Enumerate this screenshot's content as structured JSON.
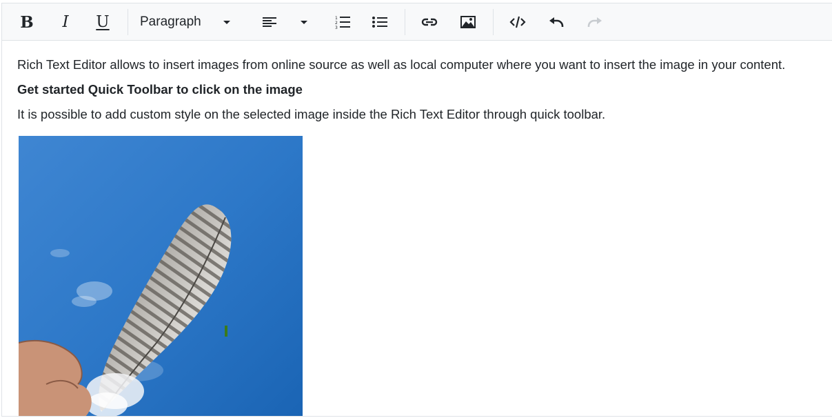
{
  "toolbar": {
    "bold_label": "B",
    "italic_label": "I",
    "underline_label": "U",
    "format_value": "Paragraph",
    "icons": [
      "bold-icon",
      "italic-icon",
      "underline-icon",
      "chevron-down-icon",
      "align-left-icon",
      "ordered-list-icon",
      "unordered-list-icon",
      "link-icon",
      "image-icon",
      "source-code-icon",
      "undo-icon",
      "redo-icon"
    ]
  },
  "content": {
    "paragraph1": "Rich Text Editor allows to insert images from online source as well as local computer where you want to insert the image in your content.",
    "heading": "Get started Quick Toolbar to click on the image",
    "paragraph2": "It is possible to add custom style on the selected image inside the Rich Text Editor through quick toolbar."
  },
  "colors": {
    "toolbar_bg": "#f8f9fa",
    "border": "#dee2e6",
    "text": "#212529",
    "sky": "#2f76c8",
    "disabled_icon": "#c8ccd0"
  }
}
